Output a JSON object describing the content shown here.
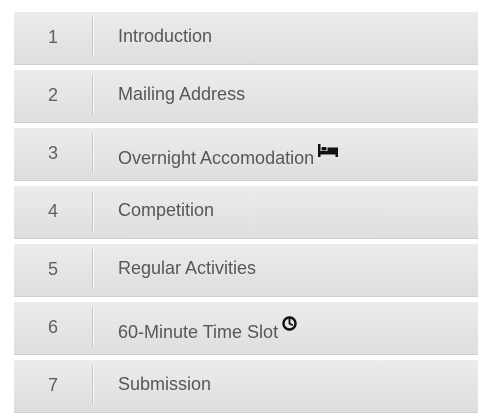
{
  "steps": [
    {
      "number": "1",
      "label": "Introduction",
      "icon": null
    },
    {
      "number": "2",
      "label": "Mailing Address",
      "icon": null
    },
    {
      "number": "3",
      "label": "Overnight Accomodation",
      "icon": "bed-icon"
    },
    {
      "number": "4",
      "label": "Competition",
      "icon": null
    },
    {
      "number": "5",
      "label": "Regular Activities",
      "icon": null
    },
    {
      "number": "6",
      "label": "60-Minute Time Slot",
      "icon": "clock-icon"
    },
    {
      "number": "7",
      "label": "Submission",
      "icon": null
    }
  ]
}
